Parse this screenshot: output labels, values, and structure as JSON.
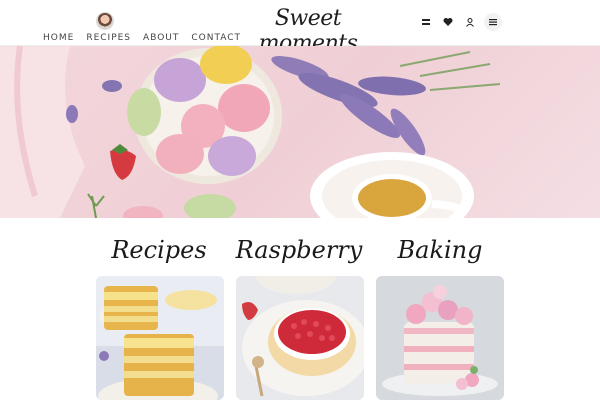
{
  "header": {
    "logo": "Sweet moments",
    "nav": [
      {
        "label": "HOME"
      },
      {
        "label": "RECIPES"
      },
      {
        "label": "ABOUT"
      },
      {
        "label": "CONTACT"
      }
    ],
    "icons": [
      "filter-icon",
      "heart-icon",
      "user-icon",
      "menu-icon"
    ]
  },
  "hero": {
    "image": "macarons-lavender-tea-photo"
  },
  "sections": [
    {
      "title": "Recipes",
      "image": "lemon-cake-photo"
    },
    {
      "title": "Raspberry",
      "image": "raspberry-tart-photo"
    },
    {
      "title": "Baking",
      "image": "floral-cake-photo"
    }
  ],
  "colors": {
    "accent": "#f0c6cf",
    "background": "#ffffff"
  }
}
